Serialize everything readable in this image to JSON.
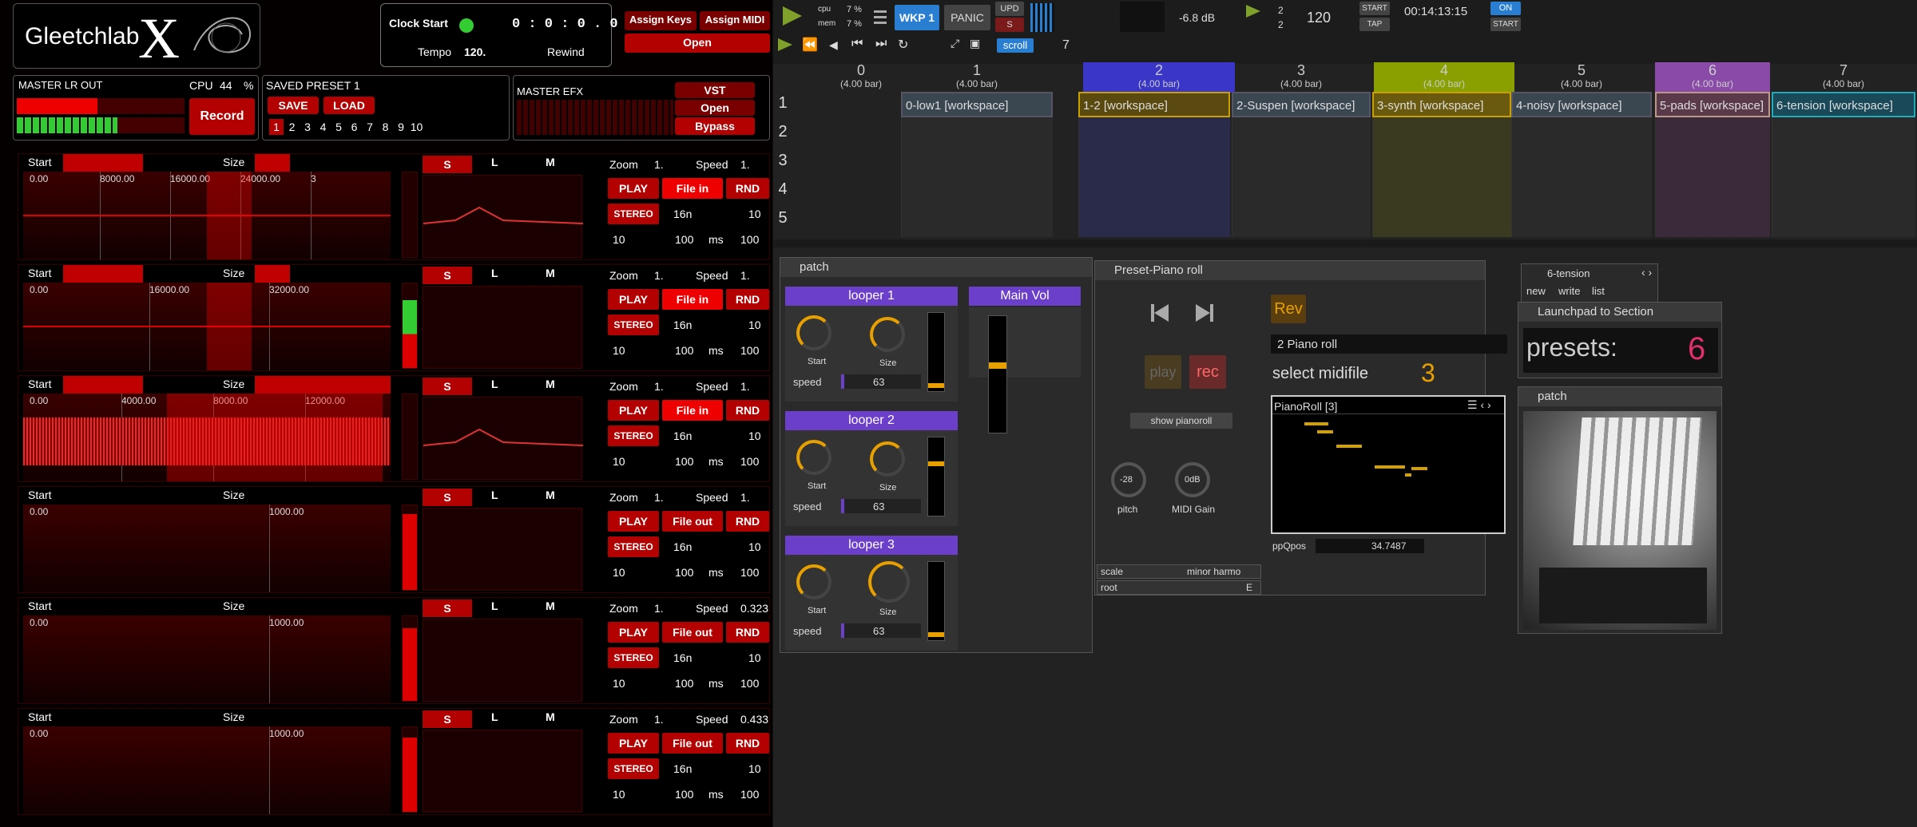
{
  "left": {
    "logo": {
      "name": "Gleetchlab",
      "suffix": "X"
    },
    "clock": {
      "start_label": "Clock Start",
      "time": "0 : 0 : 0 . 0",
      "tempo_label": "Tempo",
      "tempo_value": "120.",
      "rewind_label": "Rewind"
    },
    "assign_keys": "Assign Keys",
    "assign_midi": "Assign MIDI",
    "open": "Open",
    "master_lr": "MASTER LR OUT",
    "cpu_label": "CPU",
    "cpu_value": "44",
    "cpu_unit": "%",
    "record": "Record",
    "preset": {
      "title": "SAVED PRESET 1",
      "save": "SAVE",
      "load": "LOAD",
      "slots": [
        "1",
        "2",
        "3",
        "4",
        "5",
        "6",
        "7",
        "8",
        "9",
        "10"
      ]
    },
    "master_efx": "MASTER EFX",
    "vst": "VST",
    "efx_open": "Open",
    "bypass": "Bypass",
    "tracks": [
      {
        "start": "Start",
        "size": "Size",
        "ticks": [
          "0.00",
          "8000.00",
          "16000.00",
          "24000.00",
          "3"
        ],
        "s": "S",
        "l": "L",
        "m": "M",
        "zoom_label": "Zoom",
        "zoom": "1.",
        "speed_label": "Speed",
        "speed": "1.",
        "play": "PLAY",
        "file": "File in",
        "rnd": "RND",
        "stereo": "STEREO",
        "div": "16n",
        "v1": "10",
        "v2": "10",
        "ms": "100",
        "ms_unit": "ms",
        "v3": "100"
      },
      {
        "start": "Start",
        "size": "Size",
        "ticks": [
          "0.00",
          "16000.00",
          "32000.00"
        ],
        "s": "S",
        "l": "L",
        "m": "M",
        "zoom_label": "Zoom",
        "zoom": "1.",
        "speed_label": "Speed",
        "speed": "1.",
        "play": "PLAY",
        "file": "File in",
        "rnd": "RND",
        "stereo": "STEREO",
        "div": "16n",
        "v1": "10",
        "v2": "10",
        "ms": "100",
        "ms_unit": "ms",
        "v3": "100"
      },
      {
        "start": "Start",
        "size": "Size",
        "ticks": [
          "0.00",
          "4000.00",
          "8000.00",
          "12000.00"
        ],
        "s": "S",
        "l": "L",
        "m": "M",
        "zoom_label": "Zoom",
        "zoom": "1.",
        "speed_label": "Speed",
        "speed": "1.",
        "play": "PLAY",
        "file": "File in",
        "rnd": "RND",
        "stereo": "STEREO",
        "div": "16n",
        "v1": "10",
        "v2": "10",
        "ms": "100",
        "ms_unit": "ms",
        "v3": "100"
      },
      {
        "start": "Start",
        "size": "Size",
        "ticks": [
          "0.00",
          "1000.00"
        ],
        "s": "S",
        "l": "L",
        "m": "M",
        "zoom_label": "Zoom",
        "zoom": "1.",
        "speed_label": "Speed",
        "speed": "1.",
        "play": "PLAY",
        "file": "File out",
        "rnd": "RND",
        "stereo": "STEREO",
        "div": "16n",
        "v1": "10",
        "v2": "10",
        "ms": "100",
        "ms_unit": "ms",
        "v3": "100"
      },
      {
        "start": "Start",
        "size": "Size",
        "ticks": [
          "0.00",
          "1000.00"
        ],
        "s": "S",
        "l": "L",
        "m": "M",
        "zoom_label": "Zoom",
        "zoom": "1.",
        "speed_label": "Speed",
        "speed": "0.323",
        "play": "PLAY",
        "file": "File out",
        "rnd": "RND",
        "stereo": "STEREO",
        "div": "16n",
        "v1": "10",
        "v2": "10",
        "ms": "100",
        "ms_unit": "ms",
        "v3": "100"
      },
      {
        "start": "Start",
        "size": "Size",
        "ticks": [
          "0.00",
          "1000.00"
        ],
        "s": "S",
        "l": "L",
        "m": "M",
        "zoom_label": "Zoom",
        "zoom": "1.",
        "speed_label": "Speed",
        "speed": "0.433",
        "play": "PLAY",
        "file": "File out",
        "rnd": "RND",
        "stereo": "STEREO",
        "div": "16n",
        "v1": "10",
        "v2": "10",
        "ms": "100",
        "ms_unit": "ms",
        "v3": "100"
      }
    ]
  },
  "right": {
    "top": {
      "cpu_label": "cpu",
      "cpu_val": "7 %",
      "mem_label": "mem",
      "mem_val": "7 %",
      "wkp": "WKP 1",
      "panic": "PANIC",
      "upd": "UPD",
      "s": "S",
      "db": "-6.8 dB",
      "meter": "2",
      "meter_bottom": "2",
      "tempo": "120",
      "start": "START",
      "tap": "TAP",
      "clock": "00:14:13:15",
      "on": "ON",
      "start2": "START",
      "scroll": "scroll",
      "seven": "7"
    },
    "scenes": [
      {
        "num": "0",
        "bars": "(4.00 bar)"
      },
      {
        "num": "1",
        "bars": "(4.00 bar)"
      },
      {
        "num": "2",
        "bars": "(4.00 bar)"
      },
      {
        "num": "3",
        "bars": "(4.00 bar)"
      },
      {
        "num": "4",
        "bars": "(4.00 bar)"
      },
      {
        "num": "5",
        "bars": "(4.00 bar)"
      },
      {
        "num": "6",
        "bars": "(4.00 bar)"
      },
      {
        "num": "7",
        "bars": "(4.00 bar)"
      }
    ],
    "clips": [
      {
        "name": "0-low1 [workspace]"
      },
      {
        "name": "1-2 [workspace]"
      },
      {
        "name": "2-Suspen [workspace]"
      },
      {
        "name": "3-synth [workspace]"
      },
      {
        "name": "4-noisy [workspace]"
      },
      {
        "name": "5-pads [workspace]"
      },
      {
        "name": "6-tension [workspace]"
      }
    ],
    "rows": [
      "1",
      "2",
      "3",
      "4",
      "5"
    ],
    "patch": {
      "title": "patch",
      "loopers": [
        {
          "name": "looper 1",
          "start": "Start",
          "size": "Size",
          "speed": "speed",
          "speed_val": "63"
        },
        {
          "name": "looper 2",
          "start": "Start",
          "size": "Size",
          "speed": "speed",
          "speed_val": "63"
        },
        {
          "name": "looper 3",
          "start": "Start",
          "size": "Size",
          "speed": "speed",
          "speed_val": "63"
        }
      ],
      "main_vol": "Main Vol"
    },
    "piano": {
      "title": "Preset-Piano roll",
      "rev": "Rev",
      "play": "play",
      "rec": "rec",
      "piano_roll": "2 Piano roll",
      "select_midifile": "select midifile",
      "midifile_num": "3",
      "show": "show pianoroll",
      "pianoroll_title": "PianoRoll [3]",
      "pitch_val": "-28",
      "pitch": "pitch",
      "gain_val": "0dB",
      "gain": "MIDI Gain",
      "ppq_label": "ppQpos",
      "ppq": "34.7487",
      "scale_label": "scale",
      "scale": "minor harmo",
      "root_label": "root",
      "root": "E"
    },
    "launch": {
      "preset_name": "6-tension",
      "new": "new",
      "write": "write",
      "list": "list",
      "title": "Launchpad to Section",
      "presets_label": "presets:",
      "presets_val": "6",
      "patch": "patch"
    },
    "colors": {
      "scene2": "#3a36c8",
      "scene4": "#8aa000",
      "scene6": "#8a4aa8",
      "accent": "#e8a000",
      "purple": "#6b3fc9"
    }
  }
}
